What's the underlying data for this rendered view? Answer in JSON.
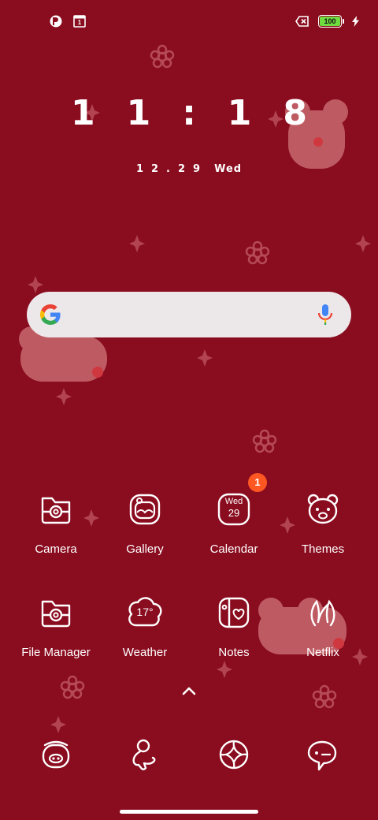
{
  "status_bar": {
    "left_icons": [
      "notification-app-icon",
      "calendar-notification-icon"
    ],
    "calendar_icon_text": "1",
    "right_icons": [
      "sim-icon",
      "battery-icon",
      "charging-icon"
    ],
    "battery_level": "100"
  },
  "clock": {
    "time": "11:18",
    "date": "12.29",
    "weekday": "Wed"
  },
  "search": {
    "logo": "google-g-logo",
    "mic": "mic-icon"
  },
  "apps": [
    {
      "label": "Camera",
      "icon": "camera-icon"
    },
    {
      "label": "Gallery",
      "icon": "gallery-icon"
    },
    {
      "label": "Calendar",
      "icon": "calendar-icon",
      "icon_weekday": "Wed",
      "icon_day": "29",
      "badge": "1"
    },
    {
      "label": "Themes",
      "icon": "themes-bear-icon"
    },
    {
      "label": "File Manager",
      "icon": "file-manager-icon"
    },
    {
      "label": "Weather",
      "icon": "weather-icon",
      "icon_temp": "17°"
    },
    {
      "label": "Notes",
      "icon": "notes-icon"
    },
    {
      "label": "Netflix",
      "icon": "netflix-icon"
    }
  ],
  "dock": [
    {
      "icon": "phone-icon"
    },
    {
      "icon": "contacts-icon"
    },
    {
      "icon": "browser-icon"
    },
    {
      "icon": "messages-icon"
    }
  ],
  "colors": {
    "wallpaper": "#8a0c1f",
    "badge": "#ff5722",
    "battery_fill": "#6fdc3f"
  }
}
